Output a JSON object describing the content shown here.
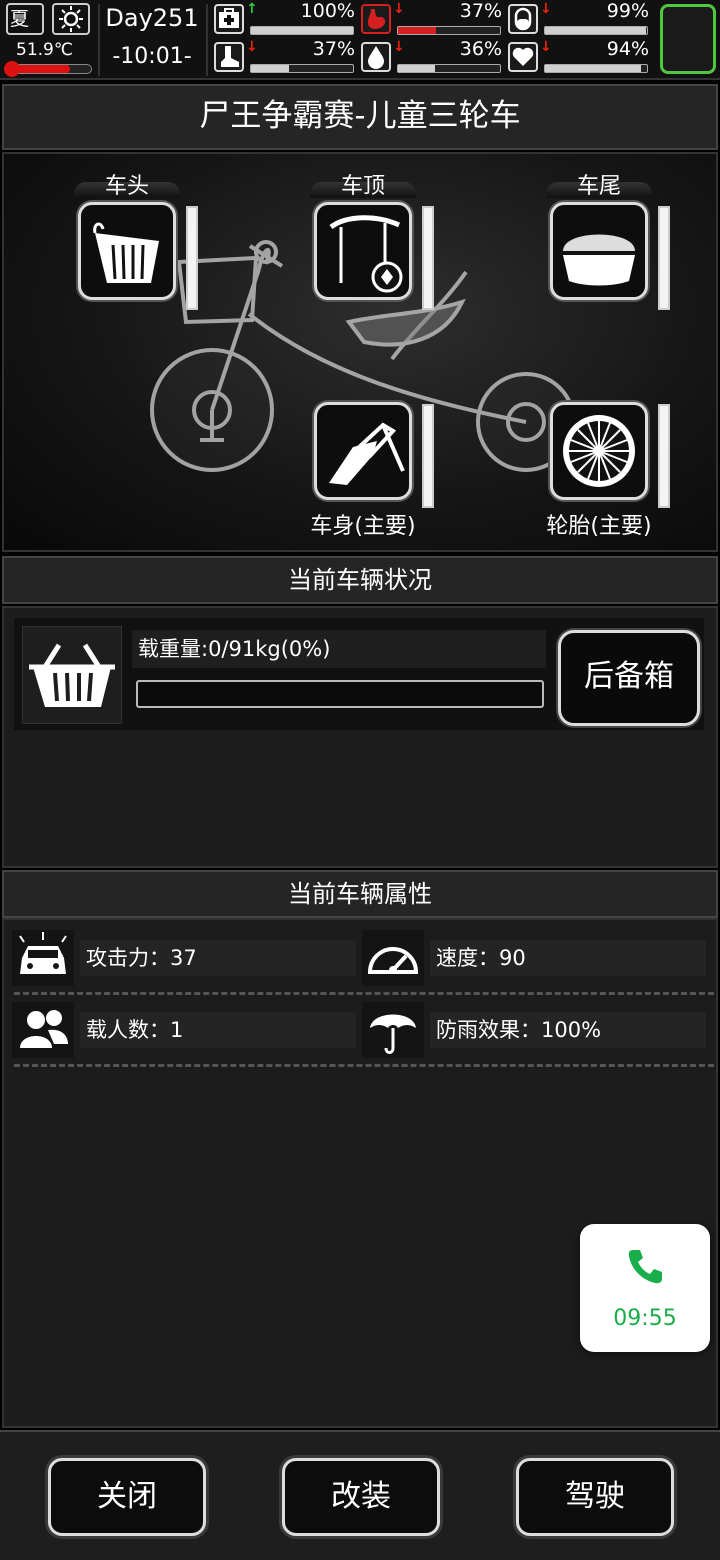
{
  "status_bar": {
    "season": "夏",
    "temperature": "51.9℃",
    "temperature_level": 0.75,
    "day": "Day251",
    "clock": "-10:01-",
    "stats": [
      {
        "name": "health",
        "icon": "medkit-icon",
        "trend": "up",
        "value": "100%",
        "level": 1.0,
        "color": "#d0d0d0"
      },
      {
        "name": "hunger",
        "icon": "stomach-icon",
        "trend": "down",
        "value": "37%",
        "level": 0.37,
        "color": "#d42020"
      },
      {
        "name": "sanity",
        "icon": "pill-icon",
        "trend": "down",
        "value": "99%",
        "level": 0.99,
        "color": "#d0d0d0"
      },
      {
        "name": "stamina",
        "icon": "foot-icon",
        "trend": "down",
        "value": "37%",
        "level": 0.37,
        "color": "#d0d0d0"
      },
      {
        "name": "thirst",
        "icon": "water-drop-icon",
        "trend": "down",
        "value": "36%",
        "level": 0.36,
        "color": "#d0d0d0"
      },
      {
        "name": "mood",
        "icon": "heart-icon",
        "trend": "down",
        "value": "94%",
        "level": 0.94,
        "color": "#d0d0d0"
      }
    ],
    "trend_symbols": {
      "up": "↑",
      "down": "↓"
    }
  },
  "vehicle": {
    "title": "尸王争霸赛-儿童三轮车",
    "slots": {
      "head": {
        "label": "车头",
        "icon": "basket-icon",
        "level": 1.0
      },
      "top": {
        "label": "车顶",
        "icon": "canopy-icon",
        "level": 0.9
      },
      "tail": {
        "label": "车尾",
        "icon": "trunk-icon",
        "level": 1.0
      },
      "body": {
        "label": "车身(主要)",
        "icon": "frame-icon",
        "level": 1.0
      },
      "tire": {
        "label": "轮胎(主要)",
        "icon": "wheel-icon",
        "level": 1.0
      }
    }
  },
  "condition": {
    "heading": "当前车辆状况",
    "load_text": "载重量:0/91kg(0%)",
    "load_level": 0.0,
    "trunk_button": "后备箱"
  },
  "attributes": {
    "heading": "当前车辆属性",
    "items": [
      {
        "icon": "car-crash-icon",
        "text": "攻击力：37"
      },
      {
        "icon": "speedometer-icon",
        "text": "速度：90"
      },
      {
        "icon": "people-icon",
        "text": "载人数：1"
      },
      {
        "icon": "umbrella-icon",
        "text": "防雨效果：100%"
      }
    ]
  },
  "call_widget": {
    "time": "09:55",
    "accent": "#1aad4b"
  },
  "footer": {
    "close": "关闭",
    "modify": "改装",
    "drive": "驾驶"
  }
}
